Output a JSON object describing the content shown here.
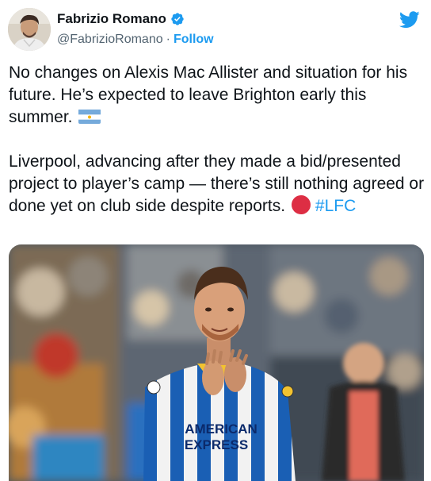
{
  "author": {
    "display_name": "Fabrizio Romano",
    "handle": "@FabrizioRomano",
    "separator": "·",
    "follow_label": "Follow",
    "verified_icon": "verified-badge-icon",
    "avatar_icon": "avatar"
  },
  "app": {
    "logo_icon": "twitter-bird-icon",
    "brand_color": "#1d9bf0"
  },
  "tweet": {
    "paragraph1": "No changes on Alexis Mac Allister and situation for his future. He’s expected to leave Brighton early this summer.",
    "flag_icon": "argentina-flag-icon",
    "paragraph2": "Liverpool, advancing after they made a bid/presented project to player’s camp — there’s still nothing agreed or done yet on club side despite reports.",
    "red_circle_icon": "red-circle-icon",
    "hashtag": "#LFC"
  },
  "media": {
    "sponsor_line1": "AMERICAN",
    "sponsor_line2": "EXPRESS",
    "kit_colors": {
      "blue": "#1a5fb4",
      "white": "#f2f2f2",
      "yellow": "#f2c230"
    }
  }
}
